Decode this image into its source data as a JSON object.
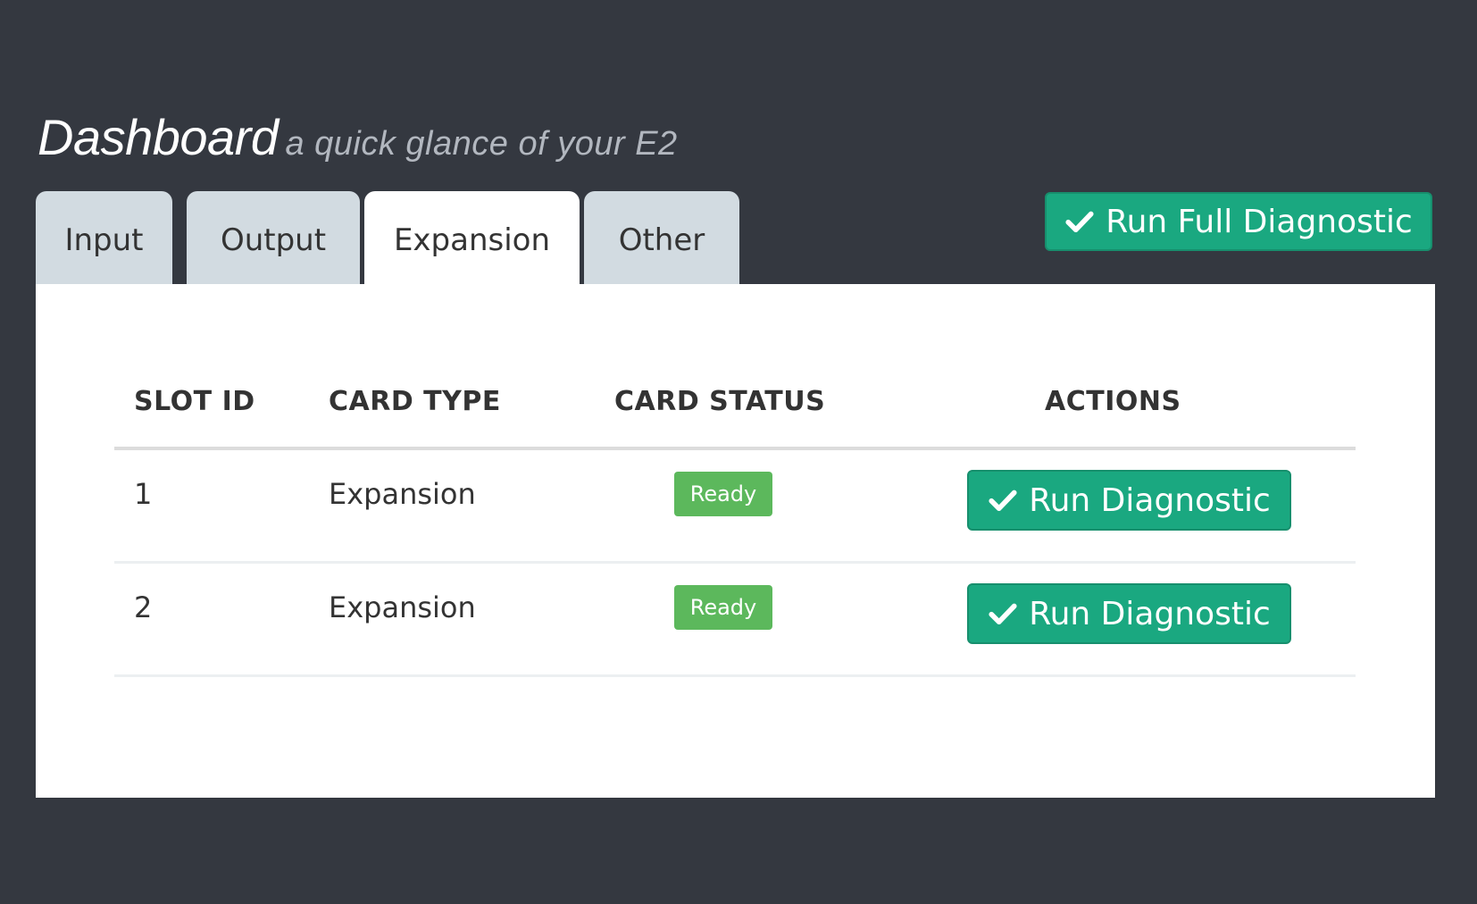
{
  "header": {
    "title": "Dashboard",
    "subtitle": "a quick glance of your E2"
  },
  "tabs": [
    {
      "label": "Input",
      "active": false
    },
    {
      "label": "Output",
      "active": false
    },
    {
      "label": "Expansion",
      "active": true
    },
    {
      "label": "Other",
      "active": false
    }
  ],
  "toolbar": {
    "full_diagnostic_label": "Run Full Diagnostic",
    "icon": "check-icon"
  },
  "table": {
    "headers": [
      "SLOT ID",
      "CARD TYPE",
      "CARD STATUS",
      "ACTIONS"
    ],
    "rows": [
      {
        "slot_id": "1",
        "card_type": "Expansion",
        "status": "Ready",
        "action": "Run Diagnostic"
      },
      {
        "slot_id": "2",
        "card_type": "Expansion",
        "status": "Ready",
        "action": "Run Diagnostic"
      }
    ]
  },
  "colors": {
    "background": "#343840",
    "accent": "#1aa880",
    "status_ready": "#5cb85c",
    "tab_inactive": "#d2dbe1"
  }
}
